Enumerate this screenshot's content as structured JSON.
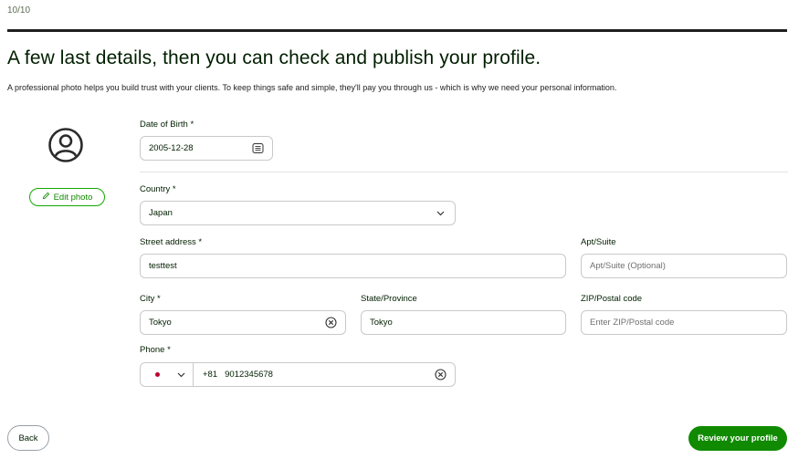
{
  "header": {
    "step": "10/10",
    "headline": "A few last details, then you can check and publish your profile.",
    "subtext": "A professional photo helps you build trust with your clients. To keep things safe and simple, they'll pay you through us - which is why we need your personal information."
  },
  "photo": {
    "avatar_icon": "user-circle-icon",
    "edit_label": "Edit photo",
    "edit_icon": "pencil-icon"
  },
  "form": {
    "dob": {
      "label": "Date of Birth *",
      "value": "2005-12-28",
      "icon": "calendar-icon"
    },
    "country": {
      "label": "Country *",
      "value": "Japan",
      "icon": "chevron-down-icon"
    },
    "street": {
      "label": "Street address *",
      "value": "testtest"
    },
    "apt": {
      "label": "Apt/Suite",
      "placeholder": "Apt/Suite (Optional)"
    },
    "city": {
      "label": "City *",
      "value": "Tokyo",
      "icon": "clear-icon"
    },
    "state": {
      "label": "State/Province",
      "value": "Tokyo"
    },
    "zip": {
      "label": "ZIP/Postal code",
      "placeholder": "Enter ZIP/Postal code"
    },
    "phone": {
      "label": "Phone *",
      "country_code": "+81",
      "value": "9012345678",
      "flag_color": "#bc002d"
    }
  },
  "actions": {
    "back_label": "Back",
    "review_label": "Review your profile"
  },
  "colors": {
    "accent": "#108a00",
    "text": "#001e00"
  }
}
